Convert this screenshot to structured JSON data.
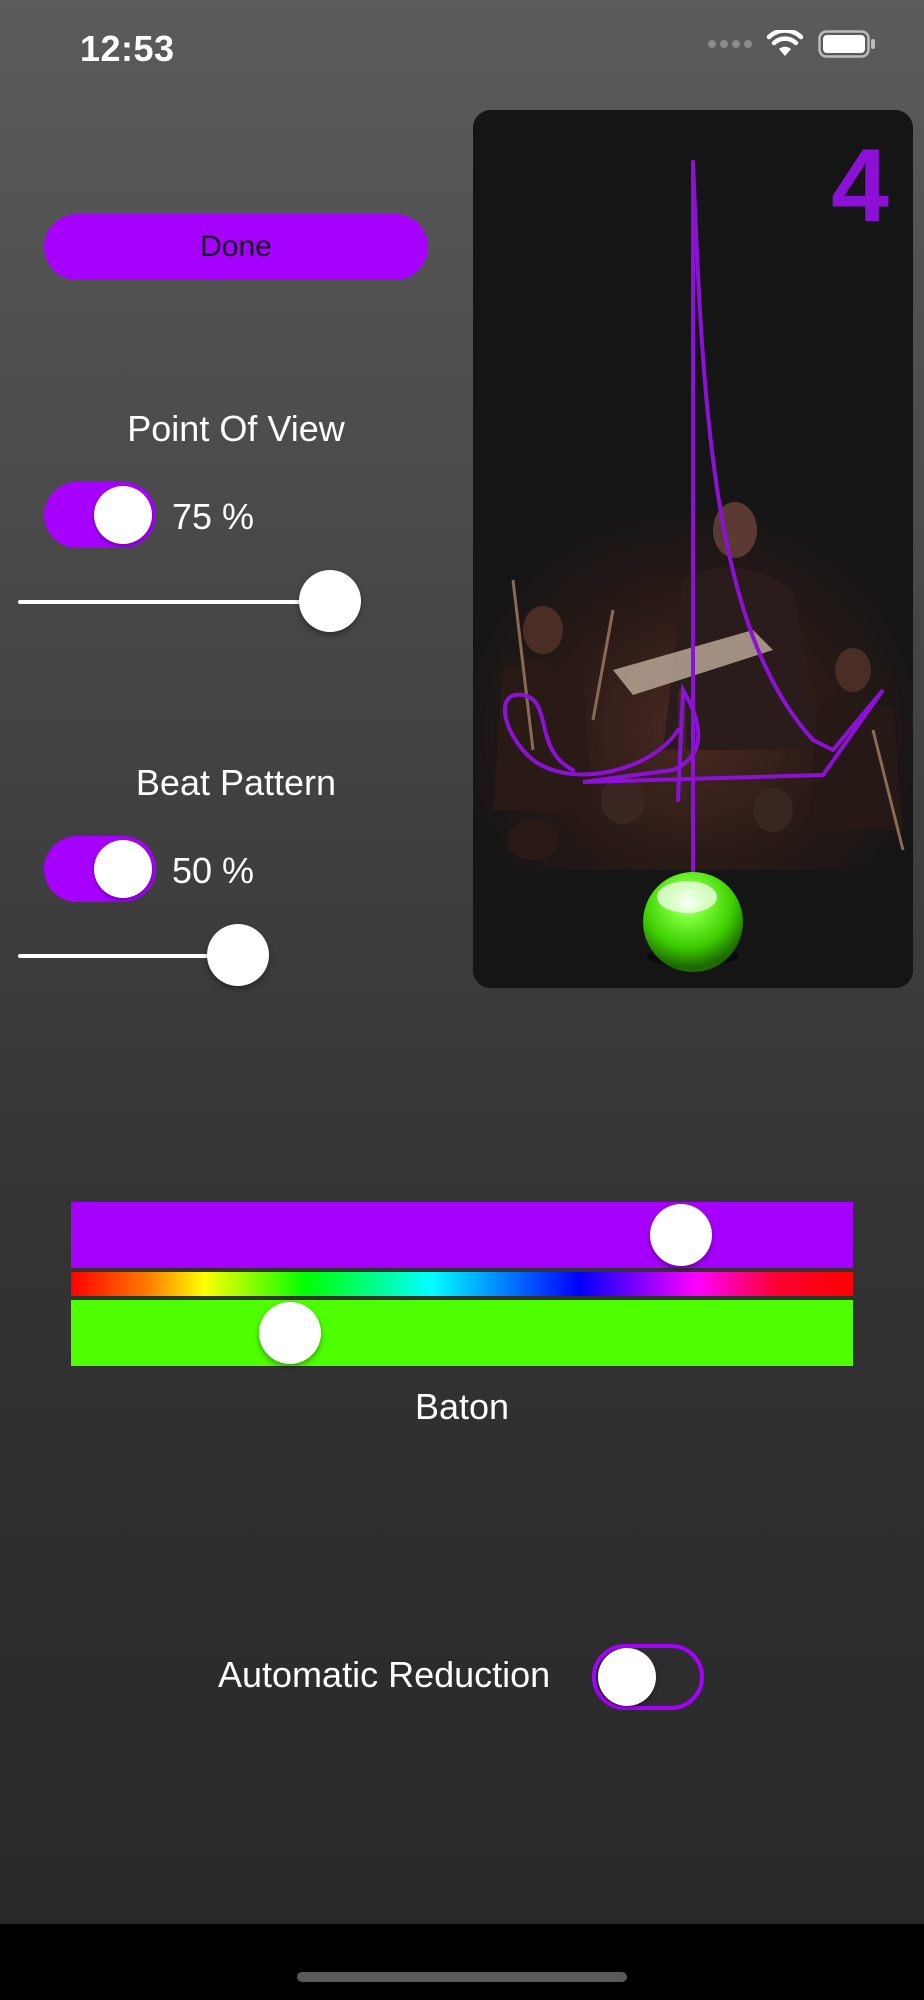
{
  "status_bar": {
    "time": "12:53",
    "icons": [
      "cellular-dots-icon",
      "wifi-icon",
      "battery-icon"
    ]
  },
  "done_button": {
    "label": "Done"
  },
  "point_of_view": {
    "title": "Point Of View",
    "toggle_on": true,
    "percent_text": "75 %",
    "slider_value": 0.82
  },
  "beat_pattern": {
    "title": "Beat Pattern",
    "toggle_on": true,
    "percent_text": "50 %",
    "slider_value": 0.58
  },
  "preview": {
    "beat_number": "4",
    "trace_color": "#8d10d6",
    "ball_color": "#4dff00"
  },
  "baton": {
    "label": "Baton",
    "primary_color": "#a600ff",
    "primary_position": 0.78,
    "secondary_color": "#4dff00",
    "secondary_position": 0.28
  },
  "automatic_reduction": {
    "label": "Automatic Reduction",
    "toggle_on": false
  },
  "colors": {
    "accent": "#a600ff",
    "background_top": "#5b5b5b",
    "background_bottom": "#272727"
  }
}
